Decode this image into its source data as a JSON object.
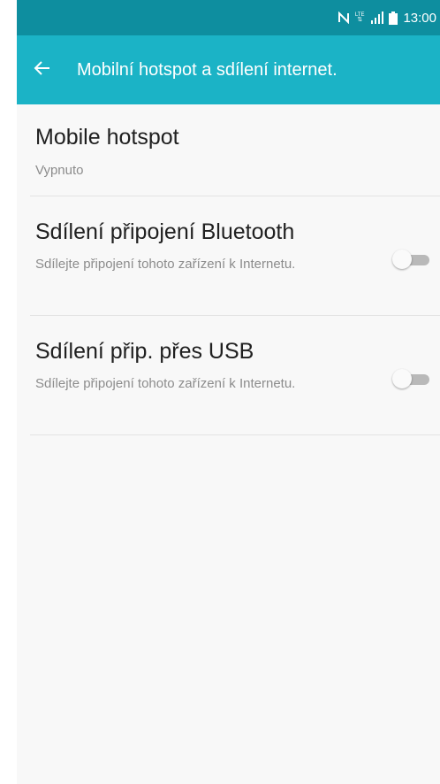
{
  "status_bar": {
    "time": "13:00",
    "icons": [
      "nfc-icon",
      "lte-icon",
      "signal-icon",
      "battery-icon"
    ],
    "lte_label": "LTE"
  },
  "app_bar": {
    "title": "Mobilní hotspot a sdílení internet.",
    "back_icon": "arrow-left-icon"
  },
  "items": [
    {
      "title": "Mobile hotspot",
      "subtitle": "Vypnuto"
    },
    {
      "title": "Sdílení připojení Bluetooth",
      "subtitle": "Sdílejte připojení tohoto zařízení k Internetu.",
      "toggle_on": false
    },
    {
      "title": "Sdílení přip. přes USB",
      "subtitle": "Sdílejte připojení tohoto zařízení k Internetu.",
      "toggle_on": false
    }
  ],
  "colors": {
    "status_bar": "#0e8e9f",
    "app_bar": "#1bb3c6",
    "background": "#f8f8f8",
    "switch_off": "#b9b9b9"
  }
}
